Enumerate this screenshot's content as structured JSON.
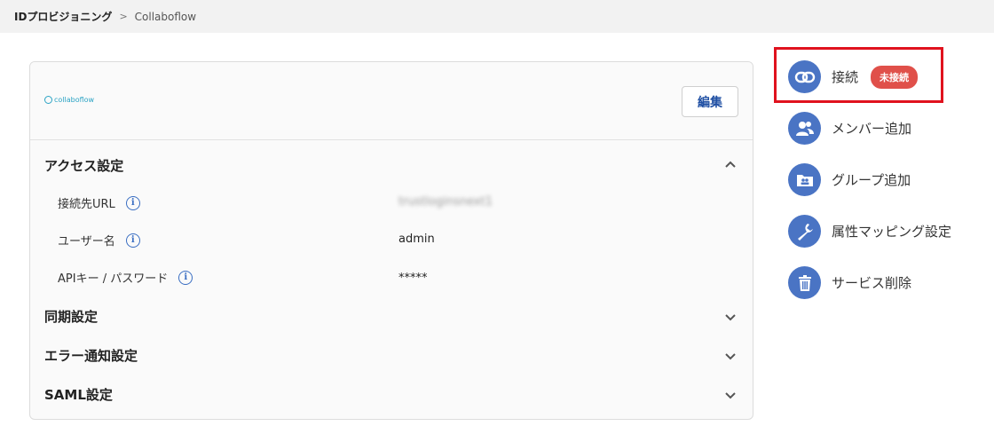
{
  "breadcrumb": {
    "root": "IDプロビジョニング",
    "separator": ">",
    "current": "Collaboflow"
  },
  "card": {
    "logo_text": "collaboflow",
    "edit_label": "編集",
    "sections": {
      "access": "アクセス設定",
      "sync": "同期設定",
      "error": "エラー通知設定",
      "saml": "SAML設定"
    },
    "fields": {
      "url_label": "接続先URL",
      "url_value": "trustloginsnext1",
      "user_label": "ユーザー名",
      "user_value": "admin",
      "api_label": "APIキー / パスワード",
      "api_value": "*****"
    },
    "info_glyph": "i"
  },
  "side_menu": {
    "connect": "接続",
    "connect_badge": "未接続",
    "add_member": "メンバー追加",
    "add_group": "グループ追加",
    "attr_mapping": "属性マッピング設定",
    "delete_service": "サービス削除"
  },
  "colors": {
    "accent": "#4a74c4",
    "badge": "#e0504a",
    "highlight": "#e0121e"
  }
}
